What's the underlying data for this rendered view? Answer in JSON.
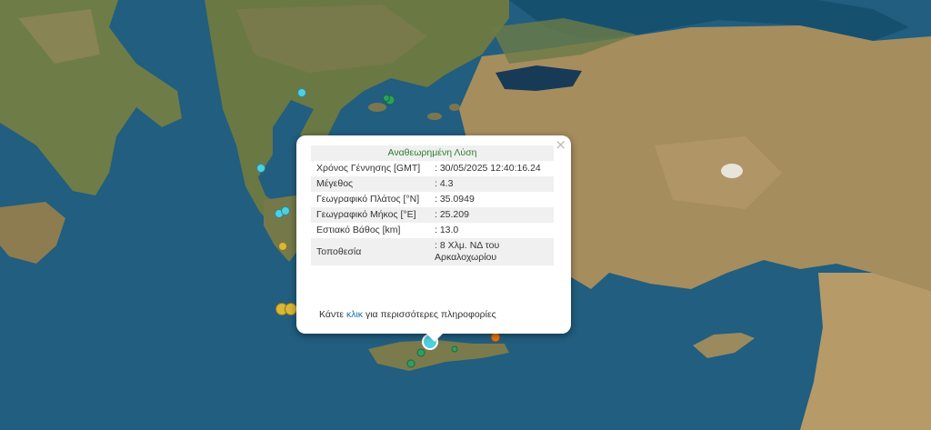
{
  "map": {
    "colors": {
      "sea_deep": "#1c5576",
      "sea_shallow": "#2b7092",
      "land_dry": "#a88f62",
      "land_green": "#6b7b45",
      "land_highlands": "#8c7a52"
    },
    "markers": [
      {
        "name": "marker-yellow",
        "color": "#d9b836"
      },
      {
        "name": "marker-cyan",
        "color": "#4fd0e0"
      },
      {
        "name": "marker-green",
        "color": "#2da060"
      },
      {
        "name": "marker-orange",
        "color": "#e07a22"
      }
    ]
  },
  "popup": {
    "close_symbol": "×",
    "title": "Αναθεωρημένη Λύση",
    "rows": [
      {
        "label": "Χρόνος Γέννησης [GMT]",
        "value": ": 30/05/2025 12:40:16.24"
      },
      {
        "label": "Μέγεθος",
        "value": ": 4.3"
      },
      {
        "label": "Γεωγραφικό Πλάτος [°N]",
        "value": ": 35.0949"
      },
      {
        "label": "Γεωγραφικό Μήκος [°E]",
        "value": ": 25.209"
      },
      {
        "label": "Εστιακό Βάθος [km]",
        "value": ": 13.0"
      },
      {
        "label": "Τοποθεσία",
        "value": ": 8 Χλμ. ΝΔ του Αρκαλοχωρίου"
      }
    ],
    "more_prefix": "Κάντε ",
    "more_link": "κλικ",
    "more_suffix": " για περισσότερες πληροφορίες"
  }
}
